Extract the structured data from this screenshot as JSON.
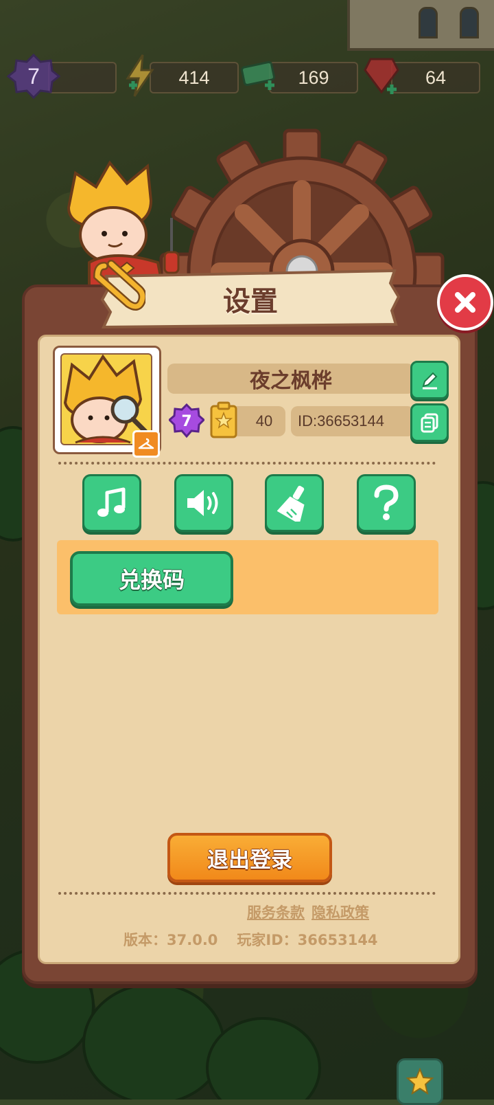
{
  "top_bar": {
    "level": "7",
    "energy": "414",
    "cash": "169",
    "gems": "64"
  },
  "dialog": {
    "title": "设置",
    "close_icon": "close-icon"
  },
  "profile": {
    "nickname": "夜之枫桦",
    "level": "7",
    "collection_count": "40",
    "id_label": "ID:36653144"
  },
  "toolbar": {
    "music_icon": "music-icon",
    "sound_icon": "speaker-icon",
    "clean_icon": "broom-icon",
    "help_icon": "question-icon"
  },
  "redeem": {
    "label": "兑换码"
  },
  "logout": {
    "label": "退出登录"
  },
  "footer": {
    "terms": "服务条款",
    "privacy": "隐私政策",
    "version": "版本：37.0.0",
    "player_id": "玩家ID：36653144"
  },
  "colors": {
    "panel_brown": "#7a4534",
    "panel_cream": "#ecd4a9",
    "button_green": "#3ccb84",
    "button_orange": "#f1891a",
    "redeem_bg": "#fbbf6a",
    "close_red": "#e23b46"
  }
}
